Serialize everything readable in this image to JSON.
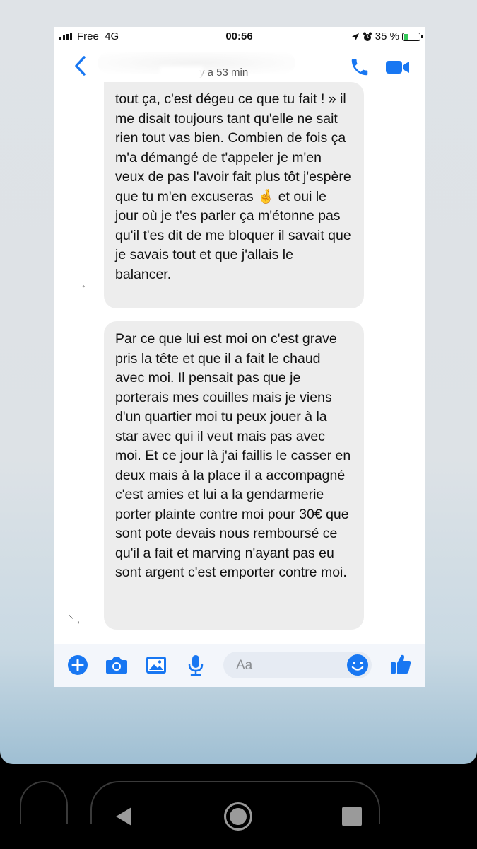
{
  "status_bar": {
    "carrier": "Free",
    "network": "4G",
    "time": "00:56",
    "battery": "35 %",
    "battery_level": 0.35
  },
  "header": {
    "back_glyph": "‹",
    "presence": "Il y a 53 min",
    "presence_visible": "y a 53 min"
  },
  "messages": [
    {
      "text": "tout ça, c'est dégeu ce que tu fait ! » il me disait toujours tant qu'elle ne sait rien tout vas bien. Combien de fois ça m'a démangé de t'appeler je m'en veux de pas l'avoir fait plus tôt j'espère que tu m'en excuseras 🤞 et oui le jour où je t'es parler ça m'étonne pas qu'il t'es dit de me bloquer il savait que je savais tout et que j'allais le balancer."
    },
    {
      "text": "Par ce que lui est moi on c'est grave pris la tête et que il a fait le chaud avec moi. Il pensait pas que je porterais mes couilles mais je viens d'un quartier moi tu peux jouer à la star avec qui il veut mais pas avec moi. Et ce jour là j'ai faillis le casser en deux mais à la place il a accompagné c'est amies et lui a la gendarmerie porter plainte contre moi pour 30€ que sont pote devais nous remboursé ce qu'il a fait et marving n'ayant pas eu sont argent c'est emporter contre moi."
    }
  ],
  "composer": {
    "placeholder": "Aa"
  },
  "colors": {
    "accent": "#1877f2",
    "bubble": "#ededed",
    "battery": "#34c759"
  },
  "icons": [
    "signal-icon",
    "location-icon",
    "alarm-icon",
    "battery-icon",
    "back-icon",
    "phone-icon",
    "video-camera-icon",
    "plus-icon",
    "camera-icon",
    "image-icon",
    "microphone-icon",
    "emoji-icon",
    "thumbs-up-icon",
    "nav-back-icon",
    "nav-home-icon",
    "nav-recents-icon"
  ]
}
